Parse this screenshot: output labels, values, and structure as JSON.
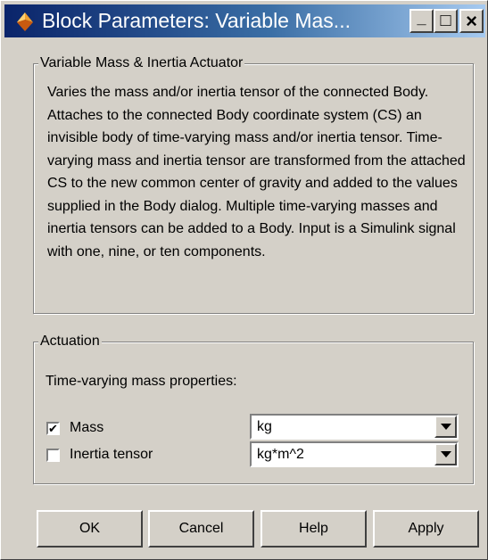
{
  "window": {
    "title": "Block Parameters: Variable Mas...",
    "min_glyph": "_",
    "max_glyph": "□",
    "close_glyph": "×"
  },
  "description_group": {
    "legend": "Variable Mass & Inertia Actuator",
    "text": "Varies the mass and/or inertia tensor of the connected Body. Attaches to the connected Body coordinate system (CS) an invisible body of time-varying mass and/or inertia tensor. Time-varying mass and inertia tensor are transformed from the attached CS to the new common center of gravity and added to the values supplied in the Body dialog. Multiple time-varying masses and inertia tensors can be added to a Body. Input is a Simulink signal with one, nine, or ten components."
  },
  "actuation_group": {
    "legend": "Actuation",
    "prompt": "Time-varying mass properties:",
    "mass": {
      "label": "Mass",
      "checked": true,
      "check_glyph": "✔",
      "unit": "kg"
    },
    "inertia": {
      "label": "Inertia tensor",
      "checked": false,
      "check_glyph": "",
      "unit": "kg*m^2"
    }
  },
  "buttons": {
    "ok": "OK",
    "cancel": "Cancel",
    "help": "Help",
    "apply": "Apply"
  },
  "colors": {
    "title_bar_start": "#0a246a",
    "title_bar_end": "#a6caf0",
    "dialog_face": "#d4d0c8",
    "icon_accent": "#e8781e"
  },
  "icons": {
    "title": "simulink-block-icon",
    "dropdown": "chevron-down-icon"
  }
}
